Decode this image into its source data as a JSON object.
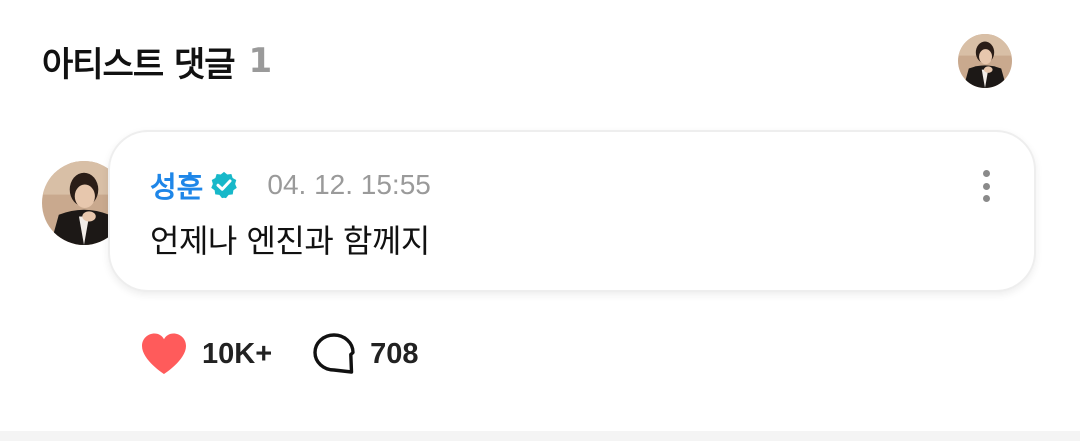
{
  "section": {
    "title": "아티스트 댓글",
    "count": "1"
  },
  "comment": {
    "author": "성훈",
    "verified": true,
    "timestamp": "04. 12. 15:55",
    "text": "언제나 엔진과 함께지"
  },
  "actions": {
    "likes": "10K+",
    "replies": "708"
  },
  "colors": {
    "author": "#1e86e8",
    "verified_badge": "#17b8c9",
    "heart": "#ff5b5b",
    "muted": "#9a9a9a"
  },
  "icons": {
    "verified": "verified-badge-icon",
    "more": "more-vertical-icon",
    "like": "heart-icon",
    "reply": "speech-bubble-icon"
  }
}
